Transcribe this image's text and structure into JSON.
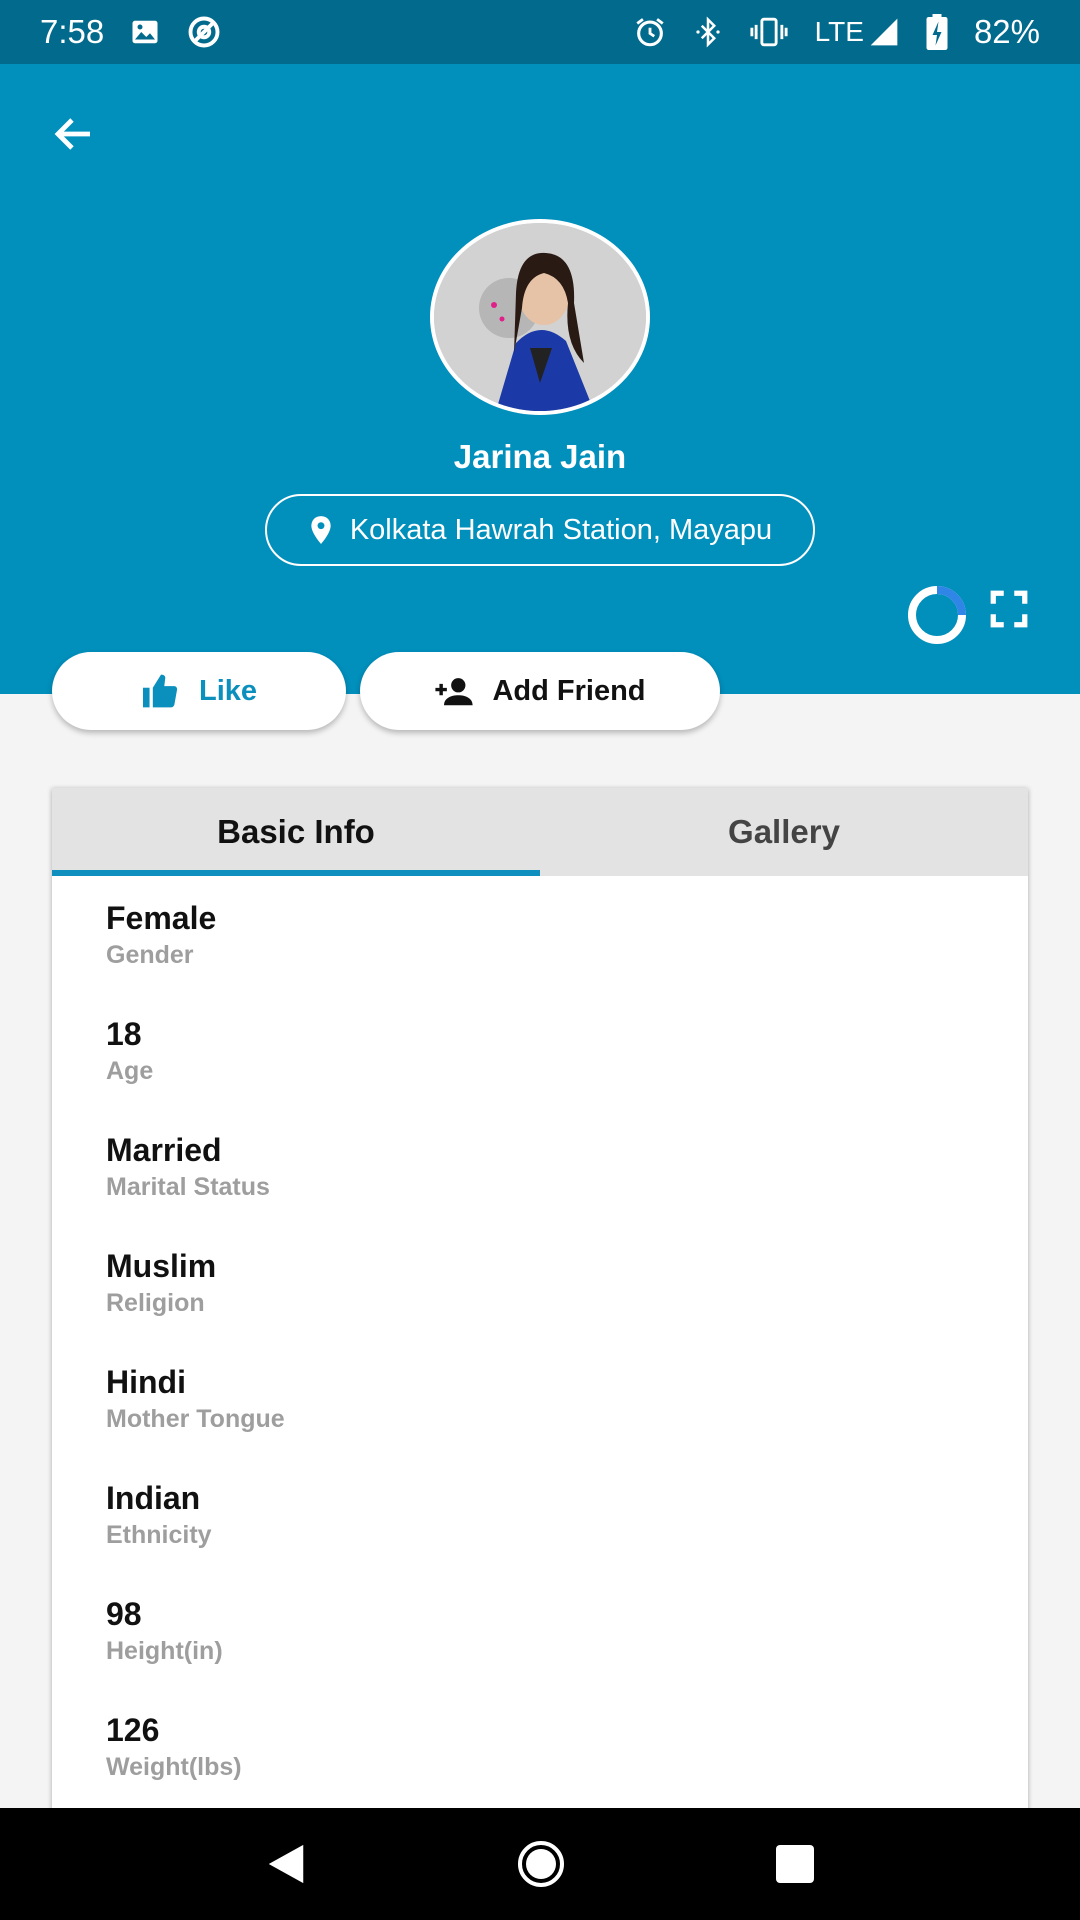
{
  "status_bar": {
    "time": "7:58",
    "network": "LTE",
    "battery": "82%",
    "icons": [
      "image-icon",
      "at-sign-icon",
      "alarm-icon",
      "bluetooth-icon",
      "vibrate-icon",
      "signal-icon",
      "battery-charging-icon"
    ]
  },
  "header": {
    "back_icon": "arrow-left-icon",
    "name": "Jarina Jain",
    "location": "Kolkata Hawrah Station, Mayapu",
    "location_icon": "map-pin-icon",
    "spinner_icon": "loading-spinner-icon",
    "expand_icon": "fullscreen-icon"
  },
  "actions": {
    "like_label": "Like",
    "add_friend_label": "Add Friend"
  },
  "tabs": [
    {
      "label": "Basic Info",
      "active": true
    },
    {
      "label": "Gallery",
      "active": false
    }
  ],
  "basic_info": [
    {
      "value": "Female",
      "label": "Gender"
    },
    {
      "value": "18",
      "label": "Age"
    },
    {
      "value": "Married",
      "label": "Marital Status"
    },
    {
      "value": "Muslim",
      "label": "Religion"
    },
    {
      "value": "Hindi",
      "label": "Mother Tongue"
    },
    {
      "value": "Indian",
      "label": "Ethnicity"
    },
    {
      "value": "98",
      "label": "Height(in)"
    },
    {
      "value": "126",
      "label": "Weight(lbs)"
    }
  ],
  "colors": {
    "header_bg": "#018fbc",
    "status_bg": "#026a8c",
    "accent": "#0e8fbd"
  }
}
